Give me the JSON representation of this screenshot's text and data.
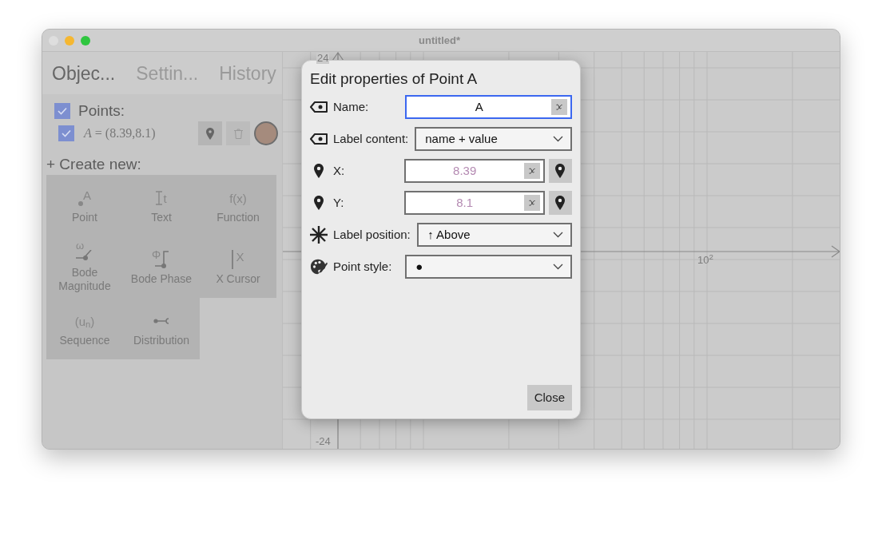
{
  "window": {
    "title": "untitled*"
  },
  "sidebar": {
    "tabs": [
      {
        "label": "Objec...",
        "selected": true
      },
      {
        "label": "Settin...",
        "selected": false
      },
      {
        "label": "History",
        "selected": false
      }
    ],
    "points": {
      "label": "Points:",
      "checked": true,
      "items": [
        {
          "label": "*A* = (8.39,8.1)",
          "checked": true,
          "color": "#a58b7d"
        }
      ]
    },
    "create_new": {
      "label": "+ Create new:",
      "tools": [
        {
          "kind": "point",
          "glyph": "A",
          "label": "Point"
        },
        {
          "kind": "text",
          "glyph": "t",
          "label": "Text"
        },
        {
          "kind": "function",
          "glyph": "f(x)",
          "label": "Function"
        },
        {
          "kind": "bode_magnitude",
          "glyph": "ω",
          "label": "Bode Magnitude"
        },
        {
          "kind": "bode_phase",
          "glyph": "Φ",
          "label": "Bode Phase"
        },
        {
          "kind": "x_cursor",
          "glyph": "X",
          "label": "X Cursor"
        },
        {
          "kind": "sequence",
          "glyph": "(u$_{n}$)",
          "label": "Sequence"
        },
        {
          "kind": "distribution",
          "label": "Distribution"
        }
      ]
    }
  },
  "graph": {
    "y_top_label": "24",
    "y_bottom_label": "-24",
    "x_label": "10$^{2}$"
  },
  "dialog": {
    "title": "Edit properties of Point A",
    "fields": [
      {
        "kind": "name",
        "label": "Name:",
        "value": "A",
        "focused": true
      },
      {
        "kind": "label_content",
        "label": "Label content:",
        "value": "name + value"
      },
      {
        "kind": "coordinate",
        "label": "X:",
        "value": "8.39",
        "focused": false
      },
      {
        "kind": "coordinate",
        "label": "Y:",
        "value": "8.1",
        "focused": false
      },
      {
        "kind": "label_position",
        "label": "Label position:",
        "value": "↑ Above"
      },
      {
        "kind": "point_style",
        "label": "Point style:",
        "value": "●"
      }
    ],
    "close_button": "Close"
  }
}
